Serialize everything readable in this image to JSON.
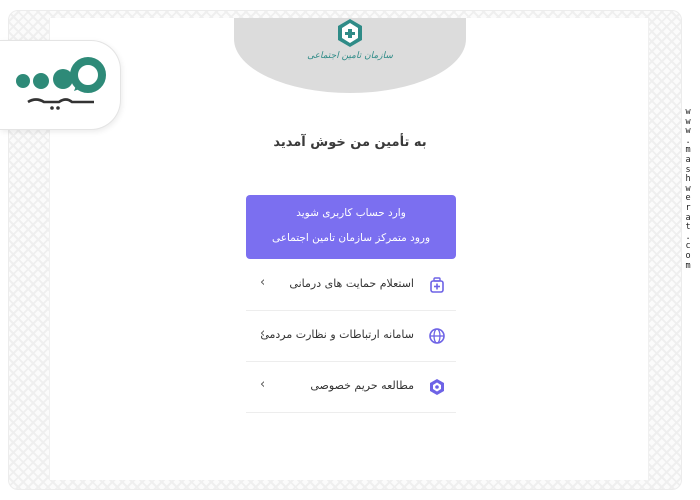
{
  "header": {
    "org_name": "سازمان تامین اجتماعی"
  },
  "welcome_title": "به تأمین من خوش آمدید",
  "login_card": {
    "line1": "وارد حساب کاربری شوید",
    "line2": "ورود متمرکز سازمان تامین اجتماعی"
  },
  "menu": [
    {
      "label": "استعلام حمایت های درمانی",
      "icon": "medical-bag-icon",
      "chevron": "‹"
    },
    {
      "label": "سامانه ارتباطات و نظارت مردمی",
      "icon": "globe-icon",
      "chevron": "‹"
    },
    {
      "label": "مطالعه حریم خصوصی",
      "icon": "shield-icon",
      "chevron": "‹"
    }
  ],
  "branding": {
    "logo_text": "مشورت",
    "watermark": "www.mashwerat.com"
  },
  "colors": {
    "accent": "#7b6ff0",
    "logo_green": "#2e8a78",
    "icon_purple": "#6e63e6",
    "header_gray": "#dcdcdc"
  }
}
